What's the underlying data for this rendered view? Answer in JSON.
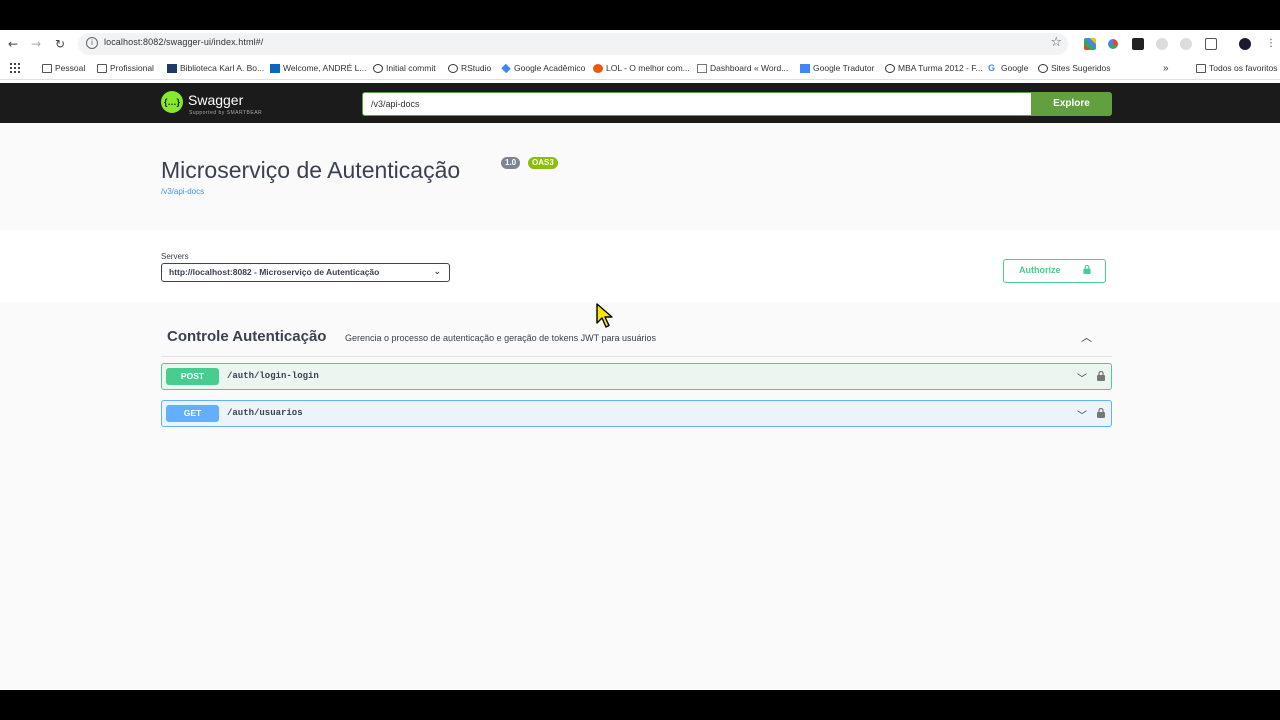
{
  "browser": {
    "url": "localhost:8082/swagger-ui/index.html#/",
    "bookmarks": [
      "Pessoal",
      "Profissional",
      "Biblioteca Karl A. Bo...",
      "Welcome, ANDRÉ L...",
      "Initial commit",
      "RStudio",
      "Google Acadêmico",
      "LOL - O melhor com...",
      "Dashboard « Word...",
      "Google Tradutor",
      "MBA Turma 2012 - F...",
      "Google",
      "Sites Sugeridos"
    ],
    "bookmarks_overflow": "»",
    "all_favorites": "Todos os favoritos"
  },
  "topbar": {
    "logo_text": "Swagger",
    "logo_sub": "Supported by SMARTBEAR",
    "explore_value": "/v3/api-docs",
    "explore_label": "Explore",
    "brand_color": "#85ea2d",
    "button_color": "#62a03f"
  },
  "info": {
    "title": "Microserviço de Autenticação",
    "version": "1.0",
    "oas": "OAS3",
    "docs_link": "/v3/api-docs"
  },
  "servers": {
    "label": "Servers",
    "selected": "http://localhost:8082 - Microserviço de Autenticação",
    "authorize_label": "Authorize"
  },
  "tag": {
    "name": "Controle Autenticação",
    "description": "Gerencia o processo de autenticação e geração de tokens JWT para usuários"
  },
  "operations": [
    {
      "method": "POST",
      "path": "/auth/login-login",
      "color": "#49cc90"
    },
    {
      "method": "GET",
      "path": "/auth/usuarios",
      "color": "#61affe"
    }
  ]
}
